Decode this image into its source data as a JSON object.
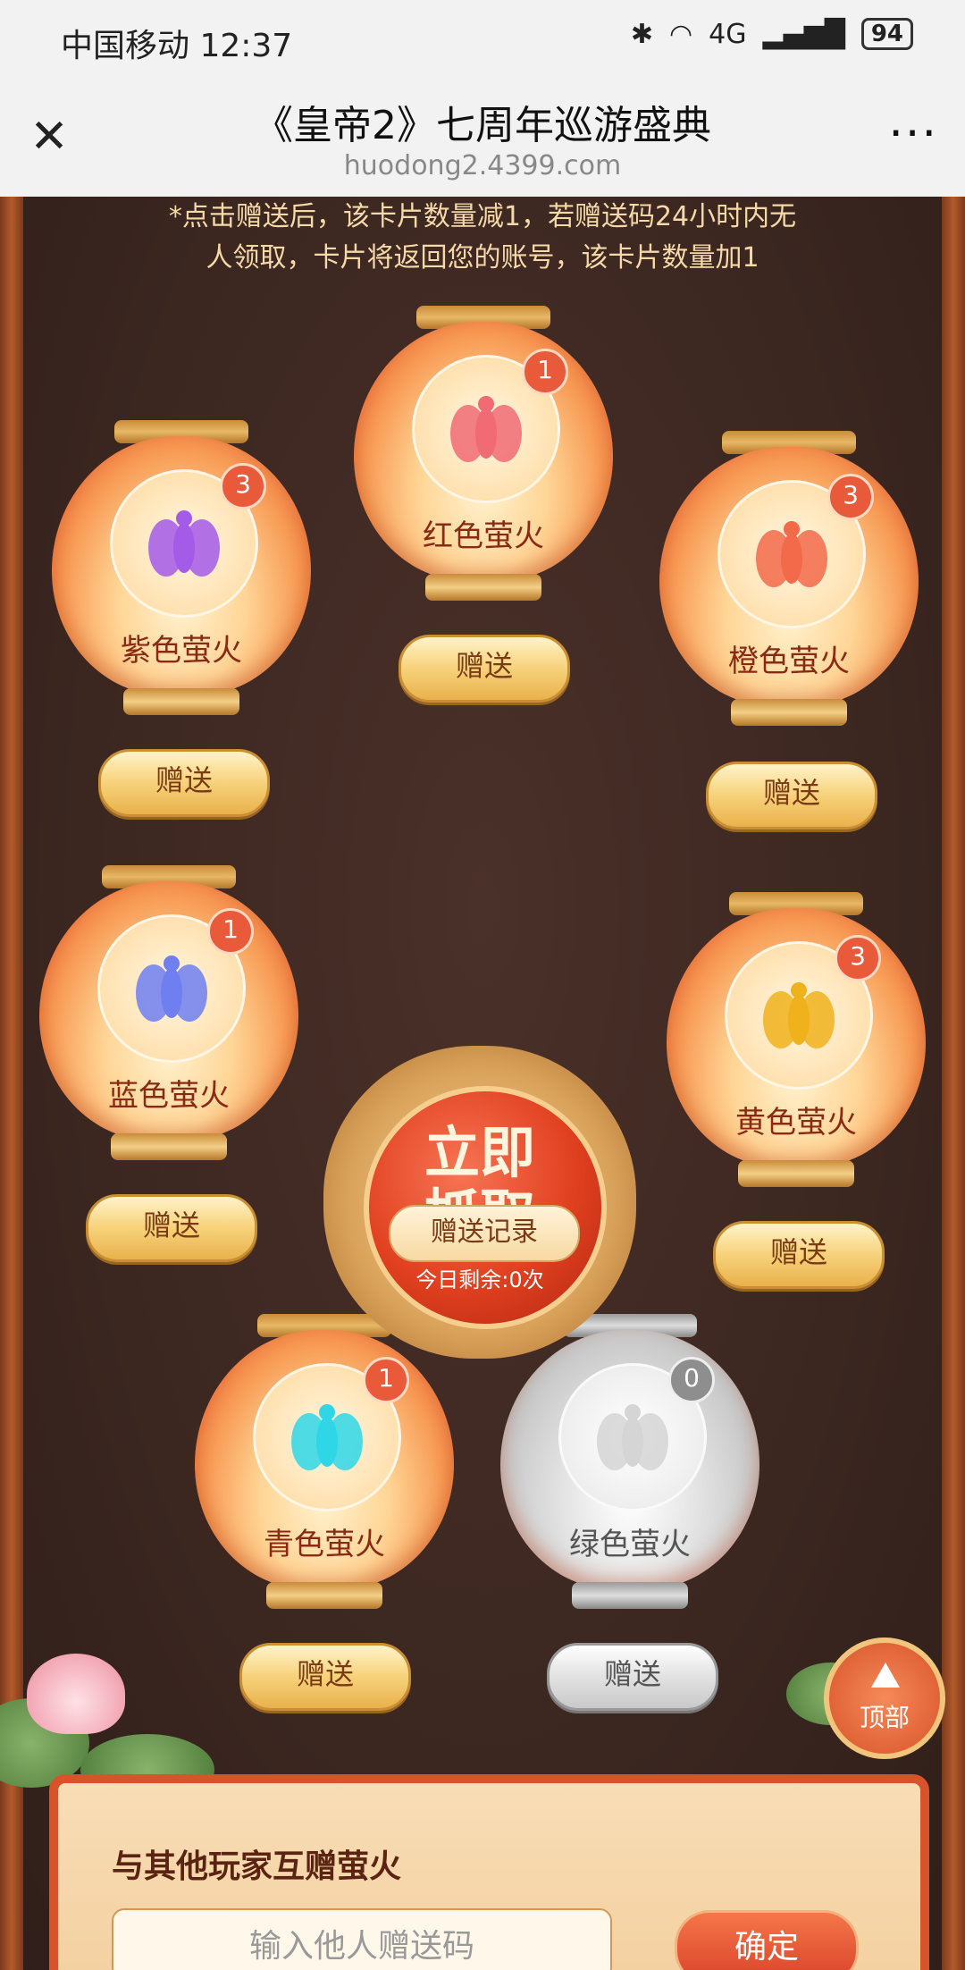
{
  "status_bar": {
    "carrier": "中国移动 12:37",
    "battery": "94",
    "network": "4G"
  },
  "title_bar": {
    "title": "《皇帝2》七周年巡游盛典",
    "url": "huodong2.4399.com",
    "close_icon": "close-icon",
    "more_icon": "more-icon"
  },
  "notice": {
    "line1": "*点击赠送后，该卡片数量减1，若赠送码24小时内无",
    "line2": "人领取，卡片将返回您的账号，该卡片数量加1"
  },
  "lanterns": [
    {
      "name": "紫色萤火",
      "count": "3",
      "color": "#a35be8",
      "gift_label": "赠送"
    },
    {
      "name": "红色萤火",
      "count": "1",
      "color": "#f06b74",
      "gift_label": "赠送"
    },
    {
      "name": "橙色萤火",
      "count": "3",
      "color": "#f26a4a",
      "gift_label": "赠送"
    },
    {
      "name": "蓝色萤火",
      "count": "1",
      "color": "#6f7ff0",
      "gift_label": "赠送"
    },
    {
      "name": "黄色萤火",
      "count": "3",
      "color": "#f0b21c",
      "gift_label": "赠送"
    },
    {
      "name": "青色萤火",
      "count": "1",
      "color": "#2fd7e6",
      "gift_label": "赠送"
    },
    {
      "name": "绿色萤火",
      "count": "0",
      "color": "#d5d5d5",
      "gift_label": "赠送"
    }
  ],
  "grab": {
    "title_line1": "立即",
    "title_line2": "抓取",
    "remaining": "今日剩余:0次"
  },
  "record_button": "赠送记录",
  "top_button": "顶部",
  "exchange": {
    "title": "与其他玩家互赠萤火",
    "placeholder": "输入他人赠送码",
    "confirm": "确定"
  }
}
